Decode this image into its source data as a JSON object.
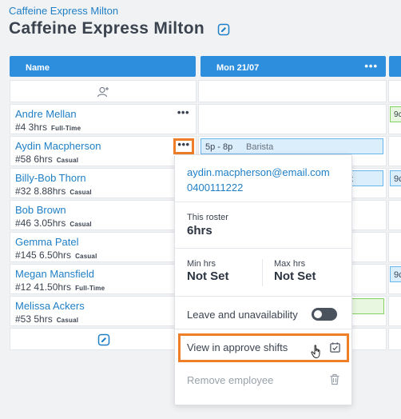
{
  "breadcrumb": "Caffeine Express Milton",
  "page_title": "Caffeine Express Milton",
  "columns": {
    "name_header": "Name",
    "day_header": "Mon 21/07",
    "more_dots": "•••"
  },
  "employees": [
    {
      "name": "Andre Mellan",
      "meta": "#4 3hrs",
      "type": "Full-Time",
      "next_shift": "9c"
    },
    {
      "name": "Aydin Macpherson",
      "meta": "#58 6hrs",
      "type": "Casual",
      "shift_time": "5p - 8p",
      "shift_role": "Barista"
    },
    {
      "name": "Billy-Bob Thorn",
      "meta": "#32 8.88hrs",
      "type": "Casual",
      "shift_tail": "t",
      "next_shift": "9c"
    },
    {
      "name": "Bob Brown",
      "meta": "#46 3.05hrs",
      "type": "Casual"
    },
    {
      "name": "Gemma Patel",
      "meta": "#145 6.50hrs",
      "type": "Casual"
    },
    {
      "name": "Megan Mansfield",
      "meta": "#12 41.50hrs",
      "type": "Full-Time",
      "next_shift": "9c"
    },
    {
      "name": "Melissa Ackers",
      "meta": "#53 5hrs",
      "type": "Casual"
    }
  ],
  "popup": {
    "email": "aydin.macpherson@email.com",
    "phone": "0400111222",
    "this_roster_label": "This roster",
    "this_roster_value": "6hrs",
    "min_hrs_label": "Min hrs",
    "min_hrs_value": "Not Set",
    "max_hrs_label": "Max hrs",
    "max_hrs_value": "Not Set",
    "leave_label": "Leave and unavailability",
    "leave_toggle_on": false,
    "approve_label": "View in approve shifts",
    "remove_label": "Remove employee"
  },
  "colors": {
    "brand_blue": "#2e8ede",
    "link_blue": "#1f7fc6",
    "highlight_orange": "#ee7e27",
    "shift_blue": "#dbeefc",
    "shift_green": "#e8f7df"
  },
  "icons": [
    "edit-roster-icon",
    "add-employee-icon",
    "trash-icon",
    "approve-check-icon",
    "hand-cursor-icon"
  ]
}
